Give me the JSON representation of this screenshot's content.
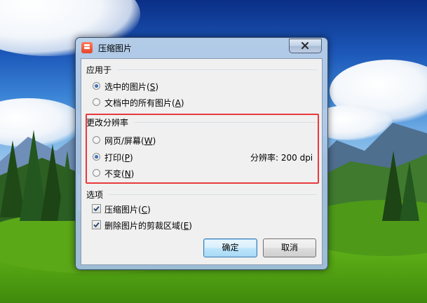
{
  "dialog": {
    "title": "压缩图片",
    "close_glyph": "×"
  },
  "apply_to": {
    "heading": "应用于",
    "options": [
      {
        "label": "选中的图片(",
        "mnemonic": "S",
        "suffix": ")",
        "selected": true
      },
      {
        "label": "文档中的所有图片(",
        "mnemonic": "A",
        "suffix": ")",
        "selected": false
      }
    ]
  },
  "resolution": {
    "heading": "更改分辨率",
    "options": [
      {
        "label": "网页/屏幕(",
        "mnemonic": "W",
        "suffix": ")",
        "selected": false
      },
      {
        "label": "打印(",
        "mnemonic": "P",
        "suffix": ")",
        "selected": true
      },
      {
        "label": "不变(",
        "mnemonic": "N",
        "suffix": ")",
        "selected": false
      }
    ],
    "dpi_text": "分辨率: 200 dpi"
  },
  "options": {
    "heading": "选项",
    "checkboxes": [
      {
        "label": "压缩图片(",
        "mnemonic": "C",
        "suffix": ")",
        "checked": true
      },
      {
        "label": "删除图片的剪裁区域(",
        "mnemonic": "E",
        "suffix": ")",
        "checked": true
      }
    ]
  },
  "buttons": {
    "ok": "确定",
    "cancel": "取消"
  },
  "colors": {
    "highlight_border": "#e8393d",
    "title_icon": "#e8452a"
  }
}
